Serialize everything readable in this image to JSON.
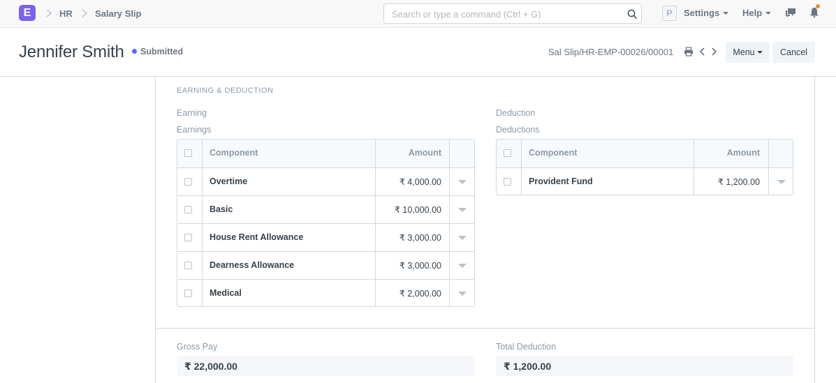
{
  "navbar": {
    "logo_letter": "E",
    "breadcrumbs": [
      "HR",
      "Salary Slip"
    ],
    "search_placeholder": "Search or type a command (Ctrl + G)",
    "avatar_letter": "P",
    "settings_label": "Settings",
    "help_label": "Help",
    "brand_color": "#7c62f2",
    "notification_dot_color": "#f28c18"
  },
  "page_head": {
    "title": "Jennifer Smith",
    "status": "Submitted",
    "status_color": "#5e64ff",
    "doc_name": "Sal Slip/HR-EMP-00026/00001",
    "menu_label": "Menu",
    "cancel_label": "Cancel"
  },
  "section": {
    "heading": "EARNING & DEDUCTION"
  },
  "earnings": {
    "field_label": "Earning",
    "table_label": "Earnings",
    "columns": [
      "Component",
      "Amount"
    ],
    "rows": [
      {
        "component": "Overtime",
        "amount": "₹ 4,000.00"
      },
      {
        "component": "Basic",
        "amount": "₹ 10,000.00"
      },
      {
        "component": "House Rent Allowance",
        "amount": "₹ 3,000.00"
      },
      {
        "component": "Dearness Allowance",
        "amount": "₹ 3,000.00"
      },
      {
        "component": "Medical",
        "amount": "₹ 2,000.00"
      }
    ]
  },
  "deductions": {
    "field_label": "Deduction",
    "table_label": "Deductions",
    "columns": [
      "Component",
      "Amount"
    ],
    "rows": [
      {
        "component": "Provident Fund",
        "amount": "₹ 1,200.00"
      }
    ]
  },
  "totals": {
    "gross_pay_label": "Gross Pay",
    "gross_pay_value": "₹ 22,000.00",
    "total_deduction_label": "Total Deduction",
    "total_deduction_value": "₹ 1,200.00"
  }
}
